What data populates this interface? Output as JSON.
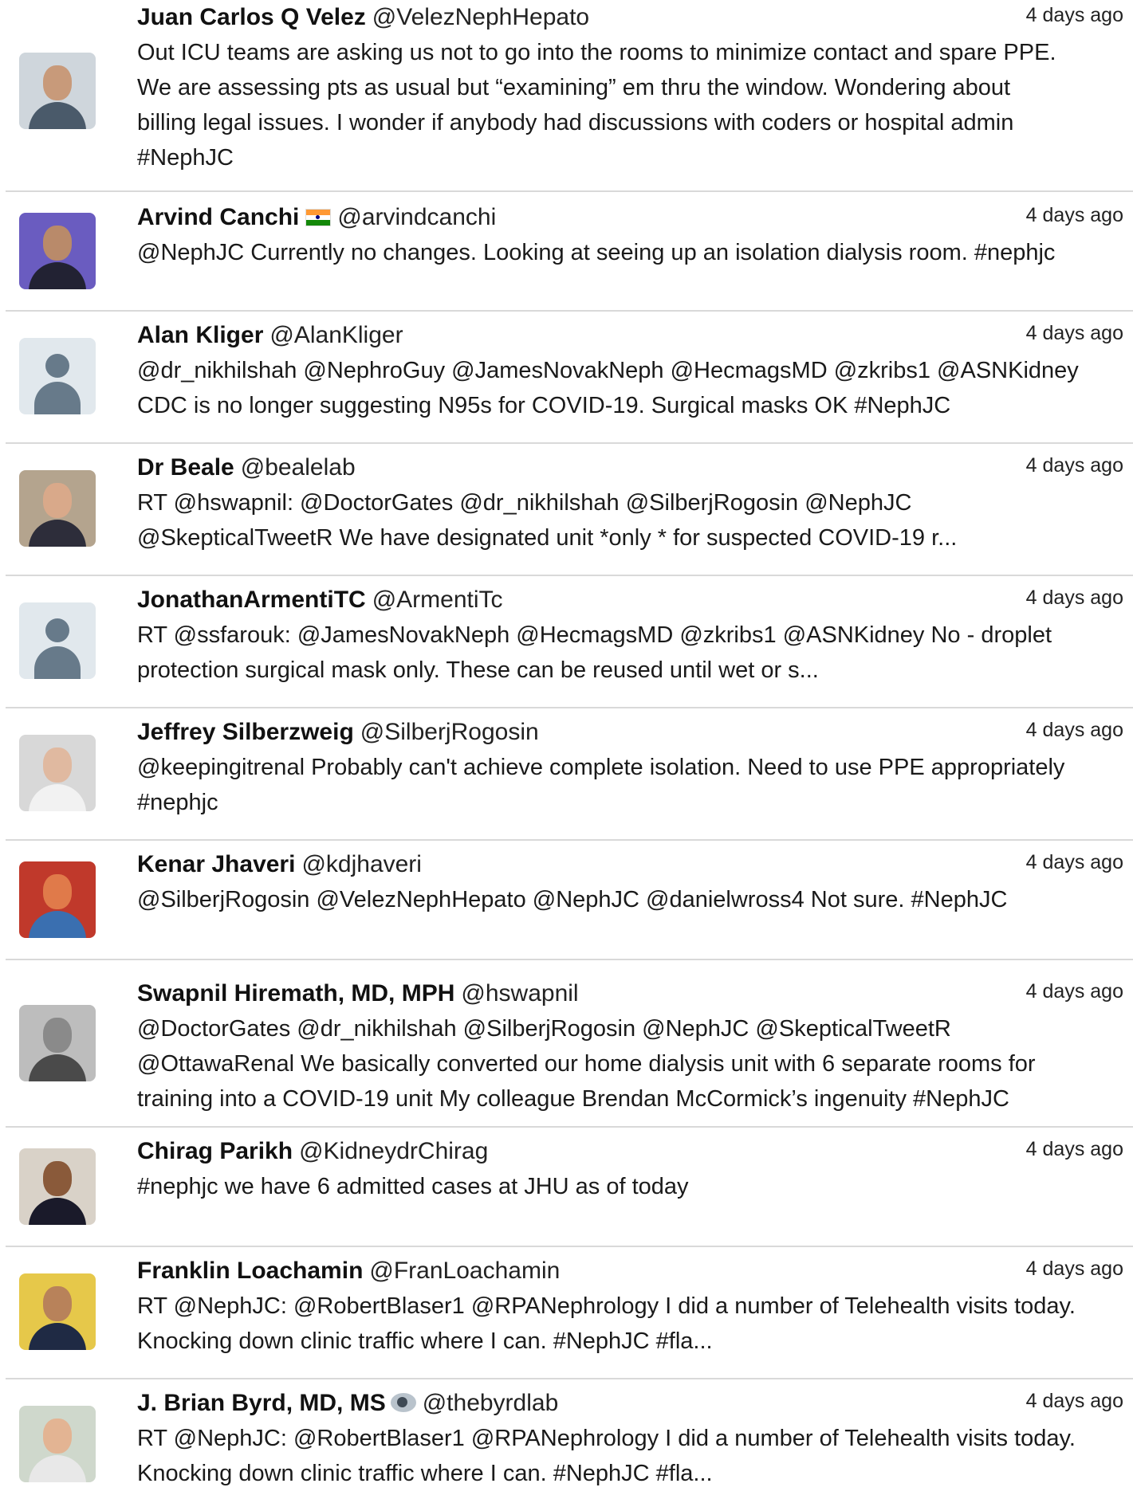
{
  "tweets": [
    {
      "name": "Juan Carlos Q Velez",
      "handle": "@VelezNephHepato",
      "time": "4 days ago",
      "text": "Out ICU teams are asking us not to go into the rooms to minimize contact and spare PPE.\nWe are assessing pts as usual but “examining” em thru the window. Wondering about\nbilling legal issues. I wonder if anybody had discussions with coders or hospital admin\n#NephJC",
      "avatar": {
        "kind": "photo",
        "bg": "#cfd6dc",
        "face": "#c89a7a",
        "body": "#4a5a6a"
      }
    },
    {
      "name": "Arvind Canchi",
      "handle": "@arvindcanchi",
      "time": "4 days ago",
      "text": "@NephJC Currently no changes. Looking at seeing up an isolation dialysis room. #nephjc",
      "avatar": {
        "kind": "photo",
        "bg": "#6a5cc0",
        "face": "#b98a6a",
        "body": "#222233"
      }
    },
    {
      "name": "Alan Kliger",
      "handle": "@AlanKliger",
      "time": "4 days ago",
      "text": "@dr_nikhilshah @NephroGuy @JamesNovakNeph @HecmagsMD @zkribs1 @ASNKidney\nCDC is no longer suggesting N95s for COVID-19. Surgical masks OK #NephJC",
      "avatar": {
        "kind": "placeholder"
      }
    },
    {
      "name": "Dr Beale",
      "handle": "@bealelab",
      "time": "4 days ago",
      "text": "RT @hswapnil: @DoctorGates @dr_nikhilshah @SilberjRogosin @NephJC\n@SkepticalTweetR We have designated unit *only * for suspected COVID-19 r...",
      "avatar": {
        "kind": "photo",
        "bg": "#b4a48e",
        "face": "#d9a98a",
        "body": "#2d2d3a"
      }
    },
    {
      "name": "JonathanArmentiTC",
      "handle": "@ArmentiTc",
      "time": "4 days ago",
      "text": "RT @ssfarouk: @JamesNovakNeph @HecmagsMD @zkribs1 @ASNKidney No - droplet\nprotection surgical mask only. These can be reused until wet or s...",
      "avatar": {
        "kind": "placeholder"
      }
    },
    {
      "name": "Jeffrey Silberzweig",
      "handle": "@SilberjRogosin",
      "time": "4 days ago",
      "text": "@keepingitrenal Probably can't achieve complete isolation. Need to use PPE appropriately\n#nephjc",
      "avatar": {
        "kind": "photo",
        "bg": "#d8d8d8",
        "face": "#e0b9a0",
        "body": "#f2f2f2"
      }
    },
    {
      "name": "Kenar Jhaveri",
      "handle": "@kdjhaveri",
      "time": "4 days ago",
      "text": "@SilberjRogosin @VelezNephHepato @NephJC @danielwross4 Not sure. #NephJC",
      "avatar": {
        "kind": "photo",
        "bg": "#c0392b",
        "face": "#e07a4a",
        "body": "#3a6fb0"
      }
    },
    {
      "name": "Swapnil Hiremath, MD, MPH",
      "handle": "@hswapnil",
      "time": "4 days ago",
      "text": "@DoctorGates @dr_nikhilshah @SilberjRogosin @NephJC @SkepticalTweetR\n@OttawaRenal We basically converted our home dialysis unit with 6 separate rooms for\ntraining into a COVID-19 unit My colleague Brendan McCormick’s ingenuity #NephJC",
      "avatar": {
        "kind": "photo",
        "bg": "#bdbdbd",
        "face": "#8a8a8a",
        "body": "#4a4a4a"
      }
    },
    {
      "name": "Chirag Parikh",
      "handle": "@KidneydrChirag",
      "time": "4 days ago",
      "text": "#nephjc we have 6 admitted cases at JHU as of today",
      "avatar": {
        "kind": "photo",
        "bg": "#d9d2c8",
        "face": "#8a5a3a",
        "body": "#1a1a2a"
      }
    },
    {
      "name": "Franklin Loachamin",
      "handle": "@FranLoachamin",
      "time": "4 days ago",
      "text": "RT @NephJC: @RobertBlaser1 @RPANephrology I did a number of Telehealth visits today.\nKnocking down clinic traffic where I can. #NephJC #fla...",
      "avatar": {
        "kind": "photo",
        "bg": "#e6c84a",
        "face": "#b8825a",
        "body": "#1f2a44"
      }
    },
    {
      "name": "J. Brian Byrd, MD, MS",
      "handle": "@thebyrdlab",
      "time": "4 days ago",
      "text": "RT @NephJC: @RobertBlaser1 @RPANephrology I did a number of Telehealth visits today.\nKnocking down clinic traffic where I can. #NephJC #fla...",
      "avatar": {
        "kind": "photo",
        "bg": "#cfd8cc",
        "face": "#e3b493",
        "body": "#e8e8e8"
      }
    }
  ]
}
